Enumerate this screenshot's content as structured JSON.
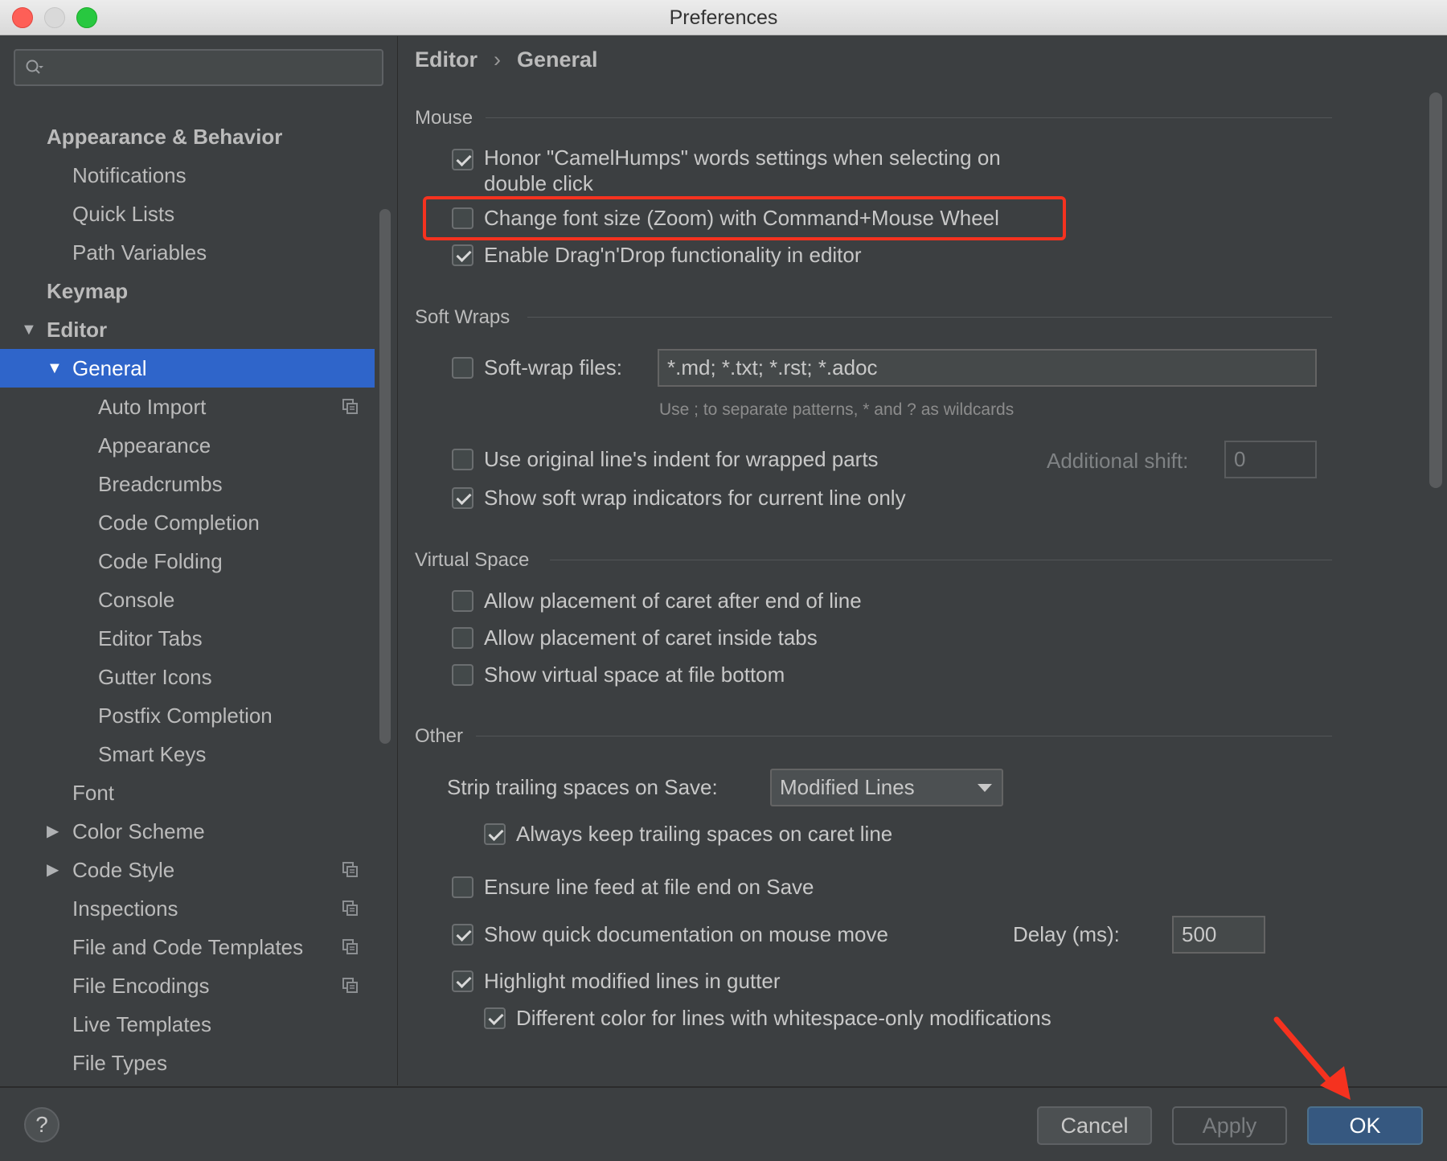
{
  "window": {
    "title": "Preferences"
  },
  "sidebar": {
    "search_placeholder": "",
    "items": [
      {
        "label": "Appearance & Behavior",
        "level": 0,
        "bold": true
      },
      {
        "label": "Notifications",
        "level": 1
      },
      {
        "label": "Quick Lists",
        "level": 1
      },
      {
        "label": "Path Variables",
        "level": 1
      },
      {
        "label": "Keymap",
        "level": 0,
        "bold": true
      },
      {
        "label": "Editor",
        "level": 0,
        "bold": true,
        "expanded": true
      },
      {
        "label": "General",
        "level": 1,
        "expanded": true,
        "selected": true
      },
      {
        "label": "Auto Import",
        "level": 2,
        "copy_icon": true
      },
      {
        "label": "Appearance",
        "level": 2
      },
      {
        "label": "Breadcrumbs",
        "level": 2
      },
      {
        "label": "Code Completion",
        "level": 2
      },
      {
        "label": "Code Folding",
        "level": 2
      },
      {
        "label": "Console",
        "level": 2
      },
      {
        "label": "Editor Tabs",
        "level": 2
      },
      {
        "label": "Gutter Icons",
        "level": 2
      },
      {
        "label": "Postfix Completion",
        "level": 2
      },
      {
        "label": "Smart Keys",
        "level": 2
      },
      {
        "label": "Font",
        "level": 1
      },
      {
        "label": "Color Scheme",
        "level": 1,
        "collapsed": true
      },
      {
        "label": "Code Style",
        "level": 1,
        "collapsed": true,
        "copy_icon": true
      },
      {
        "label": "Inspections",
        "level": 1,
        "copy_icon": true
      },
      {
        "label": "File and Code Templates",
        "level": 1,
        "copy_icon": true
      },
      {
        "label": "File Encodings",
        "level": 1,
        "copy_icon": true
      },
      {
        "label": "Live Templates",
        "level": 1
      },
      {
        "label": "File Types",
        "level": 1
      }
    ]
  },
  "breadcrumb": {
    "parent": "Editor",
    "separator": "›",
    "current": "General"
  },
  "mouse": {
    "title": "Mouse",
    "camelhumps": {
      "label_line1": "Honor \"CamelHumps\" words settings when selecting on",
      "label_line2": "double click",
      "checked": true
    },
    "zoom": {
      "label": "Change font size (Zoom) with Command+Mouse Wheel",
      "checked": false
    },
    "dragdrop": {
      "label": "Enable Drag'n'Drop functionality in editor",
      "checked": true
    }
  },
  "soft_wraps": {
    "title": "Soft Wraps",
    "softwrap_files": {
      "label": "Soft-wrap files:",
      "checked": false,
      "value": "*.md; *.txt; *.rst; *.adoc"
    },
    "hint": "Use ; to separate patterns, * and ? as wildcards",
    "original_indent": {
      "label": "Use original line's indent for wrapped parts",
      "checked": false
    },
    "additional_shift": {
      "label": "Additional shift:",
      "value": "0"
    },
    "indicators": {
      "label": "Show soft wrap indicators for current line only",
      "checked": true
    }
  },
  "virtual_space": {
    "title": "Virtual Space",
    "after_eol": {
      "label": "Allow placement of caret after end of line",
      "checked": false
    },
    "inside_tabs": {
      "label": "Allow placement of caret inside tabs",
      "checked": false
    },
    "file_bottom": {
      "label": "Show virtual space at file bottom",
      "checked": false
    }
  },
  "other": {
    "title": "Other",
    "strip": {
      "label": "Strip trailing spaces on Save:",
      "value": "Modified Lines"
    },
    "keep_trailing": {
      "label": "Always keep trailing spaces on caret line",
      "checked": true
    },
    "line_feed": {
      "label": "Ensure line feed at file end on Save",
      "checked": false
    },
    "quick_doc": {
      "label": "Show quick documentation on mouse move",
      "checked": true
    },
    "delay": {
      "label": "Delay (ms):",
      "value": "500"
    },
    "highlight_modified": {
      "label": "Highlight modified lines in gutter",
      "checked": true
    },
    "different_color": {
      "label": "Different color for lines with whitespace-only modifications",
      "checked": true
    }
  },
  "buttons": {
    "help": "?",
    "cancel": "Cancel",
    "apply": "Apply",
    "ok": "OK"
  },
  "colors": {
    "accent": "#2f65ca",
    "highlight": "#f5321f",
    "primary_button": "#365880"
  }
}
